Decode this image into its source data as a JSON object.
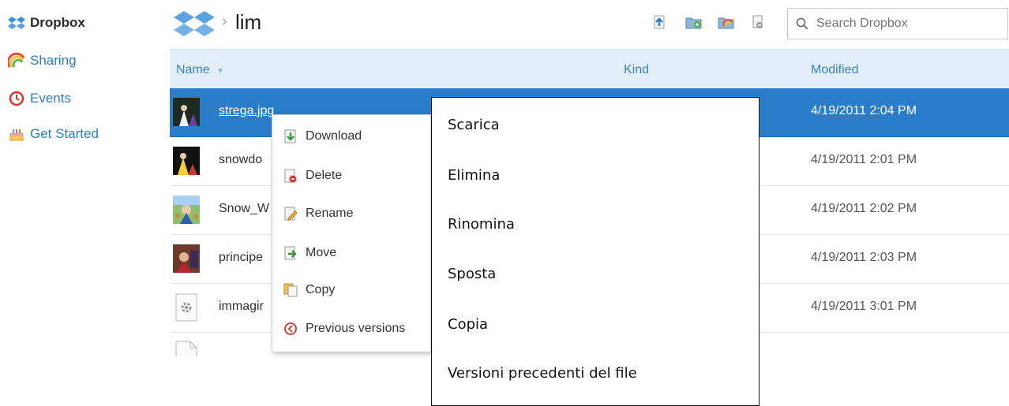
{
  "sidebar": {
    "items": [
      {
        "label": "Dropbox",
        "icon": "dropbox-icon"
      },
      {
        "label": "Sharing",
        "icon": "rainbow-icon"
      },
      {
        "label": "Events",
        "icon": "clock-icon"
      },
      {
        "label": "Get Started",
        "icon": "cake-icon"
      }
    ]
  },
  "header": {
    "breadcrumb_separator": "›",
    "folder_title": "lim",
    "search_placeholder": "Search Dropbox"
  },
  "table": {
    "columns": {
      "name": "Name",
      "sort_indicator": "▼",
      "kind": "Kind",
      "modified": "Modified"
    },
    "rows": [
      {
        "name": "strega.jpg",
        "modified": "4/19/2011 2:04 PM",
        "selected": true
      },
      {
        "name": "snowdo",
        "modified": "4/19/2011 2:01 PM"
      },
      {
        "name": "Snow_W",
        "modified": "4/19/2011 2:02 PM"
      },
      {
        "name": "principe",
        "modified": "4/19/2011 2:03 PM"
      },
      {
        "name": "immagir",
        "modified": "4/19/2011 3:01 PM"
      }
    ]
  },
  "context_menu": {
    "items": [
      {
        "label": "Download",
        "icon": "download-icon"
      },
      {
        "label": "Delete",
        "icon": "delete-icon"
      },
      {
        "label": "Rename",
        "icon": "rename-icon"
      },
      {
        "label": "Move",
        "icon": "move-icon"
      },
      {
        "label": "Copy",
        "icon": "copy-icon"
      },
      {
        "label": "Previous versions",
        "icon": "history-icon"
      }
    ]
  },
  "annotation": {
    "lines": [
      "Scarica",
      "Elimina",
      "Rinomina",
      "Sposta",
      "Copia",
      "Versioni precedenti del file"
    ]
  },
  "colors": {
    "accent": "#2a7ec9",
    "header_bg": "#e3eef8",
    "link": "#2d7cc0"
  }
}
